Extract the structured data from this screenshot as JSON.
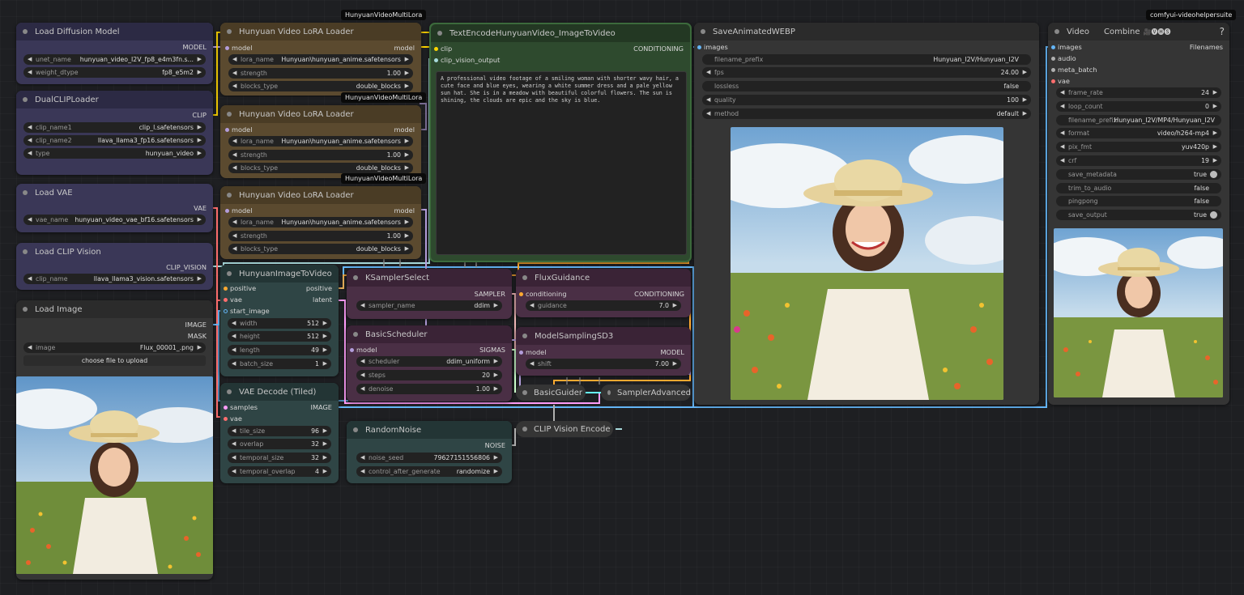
{
  "colors": {
    "purple_node": "#3a3757",
    "purple_head": "#2c2a44",
    "brown_node": "#5b4a2f",
    "brown_head": "#4a3c25",
    "green_node": "#2e4a2e",
    "teal_node": "#2f4545",
    "teal_head": "#233535",
    "plum_node": "#4a2f45",
    "plum_head": "#3a2336",
    "gray_node": "#353535",
    "gray_head": "#2b2b2b"
  },
  "load_diffusion": {
    "title": "Load Diffusion Model",
    "out_model": "MODEL",
    "unet_label": "unet_name",
    "unet_value": "hunyuan_video_I2V_fp8_e4m3fn.s...",
    "dtype_label": "weight_dtype",
    "dtype_value": "fp8_e5m2"
  },
  "dual_clip": {
    "title": "DualCLIPLoader",
    "out": "CLIP",
    "c1_label": "clip_name1",
    "c1_value": "clip_l.safetensors",
    "c2_label": "clip_name2",
    "c2_value": "llava_llama3_fp16.safetensors",
    "type_label": "type",
    "type_value": "hunyuan_video"
  },
  "load_vae": {
    "title": "Load VAE",
    "out": "VAE",
    "label": "vae_name",
    "value": "hunyuan_video_vae_bf16.safetensors"
  },
  "load_clip_vision": {
    "title": "Load CLIP Vision",
    "out": "CLIP_VISION",
    "label": "clip_name",
    "value": "llava_llama3_vision.safetensors"
  },
  "load_image": {
    "title": "Load Image",
    "out_image": "IMAGE",
    "out_mask": "MASK",
    "label": "image",
    "value": "Flux_00001_.png",
    "upload": "choose file to upload"
  },
  "lora_badge": "HunyuanVideoMultiLora",
  "lora": [
    {
      "title": "Hunyuan Video LoRA Loader",
      "in": "model",
      "out": "model",
      "name_label": "lora_name",
      "name_value": "Hunyuan\\hunyuan_anime.safetensors",
      "strength_label": "strength",
      "strength_value": "1.00",
      "blocks_label": "blocks_type",
      "blocks_value": "double_blocks"
    },
    {
      "title": "Hunyuan Video LoRA Loader",
      "in": "model",
      "out": "model",
      "name_label": "lora_name",
      "name_value": "Hunyuan\\hunyuan_anime.safetensors",
      "strength_label": "strength",
      "strength_value": "1.00",
      "blocks_label": "blocks_type",
      "blocks_value": "double_blocks"
    },
    {
      "title": "Hunyuan Video LoRA Loader",
      "in": "model",
      "out": "model",
      "name_label": "lora_name",
      "name_value": "Hunyuan\\hunyuan_anime.safetensors",
      "strength_label": "strength",
      "strength_value": "1.00",
      "blocks_label": "blocks_type",
      "blocks_value": "double_blocks"
    }
  ],
  "text_encode": {
    "title": "TextEncodeHunyuanVideo_ImageToVideo",
    "in_clip": "clip",
    "in_cv": "clip_vision_output",
    "out": "CONDITIONING",
    "prompt": "A professional video footage of a smiling woman with shorter wavy hair, a cute face and blue eyes, wearing a white summer dress and a pale yellow sun hat. She is in a meadow with beautiful colorful flowers. The sun is shining, the clouds are epic and the sky is blue."
  },
  "i2v": {
    "title": "HunyuanImageToVideo",
    "in_pos": "positive",
    "in_vae": "vae",
    "in_start": "start_image",
    "out_pos": "positive",
    "out_lat": "latent",
    "w_label": "width",
    "w_value": "512",
    "h_label": "height",
    "h_value": "512",
    "len_label": "length",
    "len_value": "49",
    "bs_label": "batch_size",
    "bs_value": "1"
  },
  "ksampler_select": {
    "title": "KSamplerSelect",
    "out": "SAMPLER",
    "label": "sampler_name",
    "value": "ddim"
  },
  "basic_scheduler": {
    "title": "BasicScheduler",
    "in": "model",
    "out": "SIGMAS",
    "sch_label": "scheduler",
    "sch_value": "ddim_uniform",
    "steps_label": "steps",
    "steps_value": "20",
    "den_label": "denoise",
    "den_value": "1.00"
  },
  "flux_guidance": {
    "title": "FluxGuidance",
    "in": "conditioning",
    "out": "CONDITIONING",
    "label": "guidance",
    "value": "7.0"
  },
  "model_sampling": {
    "title": "ModelSamplingSD3",
    "in": "model",
    "out": "MODEL",
    "label": "shift",
    "value": "7.00"
  },
  "basic_guider": {
    "title": "BasicGuider"
  },
  "sampler_adv": {
    "title": "SamplerAdvanced"
  },
  "vae_decode": {
    "title": "VAE Decode (Tiled)",
    "in_samples": "samples",
    "in_vae": "vae",
    "out": "IMAGE",
    "ts_label": "tile_size",
    "ts_value": "96",
    "ov_label": "overlap",
    "ov_value": "32",
    "tsz_label": "temporal_size",
    "tsz_value": "32",
    "tov_label": "temporal_overlap",
    "tov_value": "4"
  },
  "random_noise": {
    "title": "RandomNoise",
    "out": "NOISE",
    "seed_label": "noise_seed",
    "seed_value": "79627151556806",
    "ctrl_label": "control_after_generate",
    "ctrl_value": "randomize"
  },
  "clip_vision_encode": {
    "title": "CLIP Vision Encode"
  },
  "save_webp": {
    "title": "SaveAnimatedWEBP",
    "in": "images",
    "fp_label": "filename_prefix",
    "fp_value": "Hunyuan_I2V/Hunyuan_I2V",
    "fps_label": "fps",
    "fps_value": "24.00",
    "ll_label": "lossless",
    "ll_value": "false",
    "q_label": "quality",
    "q_value": "100",
    "m_label": "method",
    "m_value": "default"
  },
  "video_combine": {
    "title": "Video",
    "title2": "Combine",
    "emoji": "🎥🅥🅗🅢",
    "help": "?",
    "badge": "comfyui-videohelpersuite",
    "in_images": "images",
    "in_audio": "audio",
    "in_meta": "meta_batch",
    "in_vae": "vae",
    "out": "Filenames",
    "widgets": [
      {
        "label": "frame_rate",
        "value": "24",
        "kind": "num"
      },
      {
        "label": "loop_count",
        "value": "0",
        "kind": "num"
      },
      {
        "label": "filename_prefix",
        "value": "Hunyuan_I2V/MP4/Hunyuan_I2V",
        "kind": "text"
      },
      {
        "label": "format",
        "value": "video/h264-mp4",
        "kind": "num"
      },
      {
        "label": "pix_fmt",
        "value": "yuv420p",
        "kind": "num"
      },
      {
        "label": "crf",
        "value": "19",
        "kind": "num"
      },
      {
        "label": "save_metadata",
        "value": "true",
        "kind": "tog"
      },
      {
        "label": "trim_to_audio",
        "value": "false",
        "kind": "bool"
      },
      {
        "label": "pingpong",
        "value": "false",
        "kind": "bool"
      },
      {
        "label": "save_output",
        "value": "true",
        "kind": "tog"
      }
    ]
  }
}
